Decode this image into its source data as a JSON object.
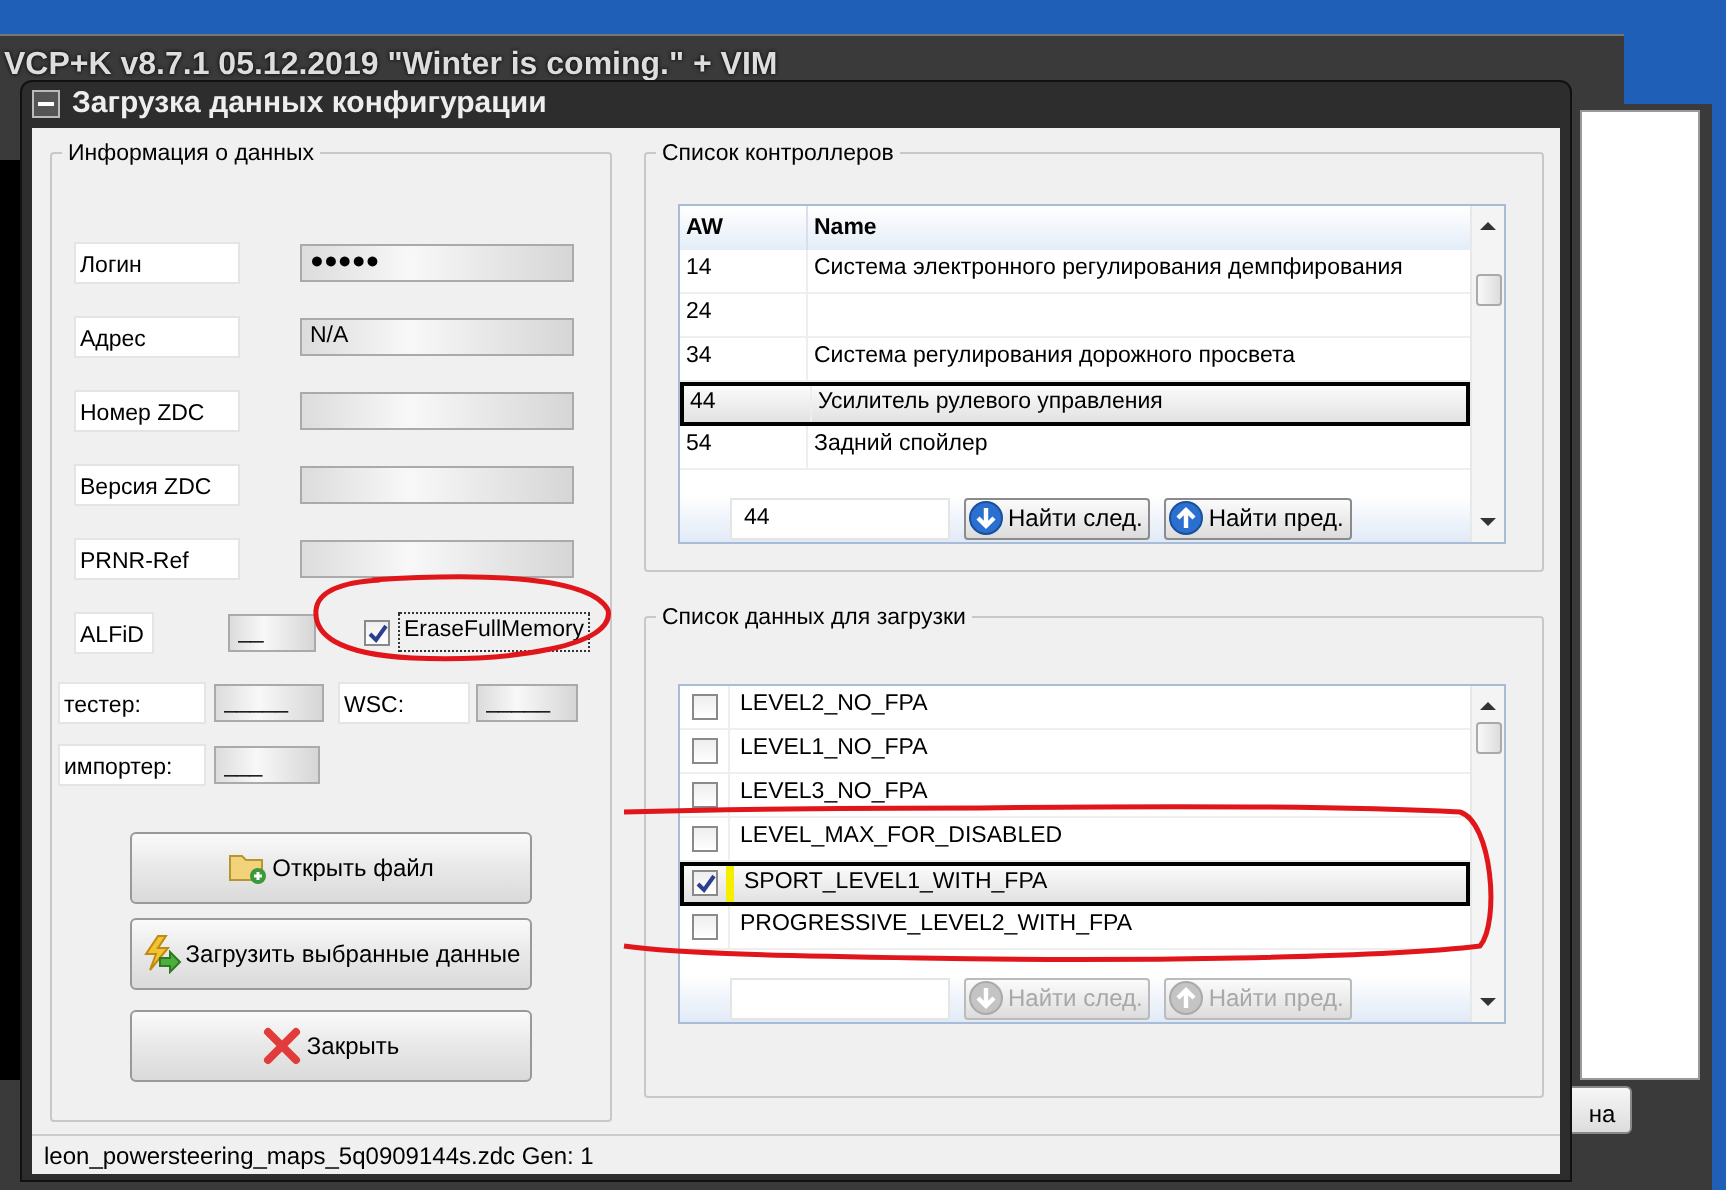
{
  "background_window": {
    "title": "VCP+K v8.7.1 05.12.2019 \"Winter is coming.\" + VIM",
    "button": "на"
  },
  "dialog": {
    "title": "Загрузка данных конфигурации",
    "status_bar": "leon_powersteering_maps_5q0909144s.zdc Gen: 1"
  },
  "data_info": {
    "title": "Информация о данных",
    "fields": [
      {
        "label": "Логин",
        "value": "●●●●●"
      },
      {
        "label": "Адрес",
        "value": "N/A"
      },
      {
        "label": "Номер ZDC"
      },
      {
        "label": "Версия ZDC"
      },
      {
        "label": "PRNR-Ref"
      }
    ],
    "alfid": {
      "label": "ALFiD",
      "value": "__"
    },
    "erase_full_memory": {
      "label": "EraseFullMemory",
      "checked": true
    },
    "tester": {
      "label": "тестер:",
      "value": "_____"
    },
    "wsc": {
      "label": "WSC:",
      "value": "_____"
    },
    "importer": {
      "label": "импортер:",
      "value": "___"
    },
    "buttons": [
      {
        "label": "Открыть файл",
        "kind": "open"
      },
      {
        "label": "Загрузить выбранные данные",
        "kind": "load"
      },
      {
        "label": "Закрыть",
        "kind": "close"
      }
    ]
  },
  "controllers": {
    "title": "Список контроллеров",
    "columns": [
      "AW",
      "Name"
    ],
    "rows": [
      {
        "aw": "14",
        "name": "Система электронного регулирования демпфирования",
        "selected": false
      },
      {
        "aw": "24",
        "selected": false
      },
      {
        "aw": "34",
        "name": "Система регулирования дорожного просвета",
        "selected": false
      },
      {
        "aw": "44",
        "name": "Усилитель рулевого управления",
        "selected": true
      },
      {
        "aw": "54",
        "name": "Задний спойлер",
        "selected": false
      }
    ],
    "search": {
      "value": "44"
    },
    "buttons": [
      {
        "label": "Найти след.",
        "kind": "down",
        "disabled": false
      },
      {
        "label": "Найти пред.",
        "kind": "up",
        "disabled": false
      }
    ]
  },
  "download_list": {
    "title": "Список данных для загрузки",
    "items": [
      {
        "label": "LEVEL2_NO_FPA",
        "checked": false,
        "selected": false
      },
      {
        "label": "LEVEL1_NO_FPA",
        "checked": false,
        "selected": false
      },
      {
        "label": "LEVEL3_NO_FPA",
        "checked": false,
        "selected": false
      },
      {
        "label": "LEVEL_MAX_FOR_DISABLED",
        "checked": false,
        "selected": false
      },
      {
        "label": "SPORT_LEVEL1_WITH_FPA",
        "checked": true,
        "selected": true
      },
      {
        "label": "PROGRESSIVE_LEVEL2_WITH_FPA",
        "checked": false,
        "selected": false
      }
    ],
    "buttons": [
      {
        "label": "Найти след.",
        "kind": "down",
        "disabled": true
      },
      {
        "label": "Найти пред.",
        "kind": "up",
        "disabled": true
      }
    ]
  }
}
